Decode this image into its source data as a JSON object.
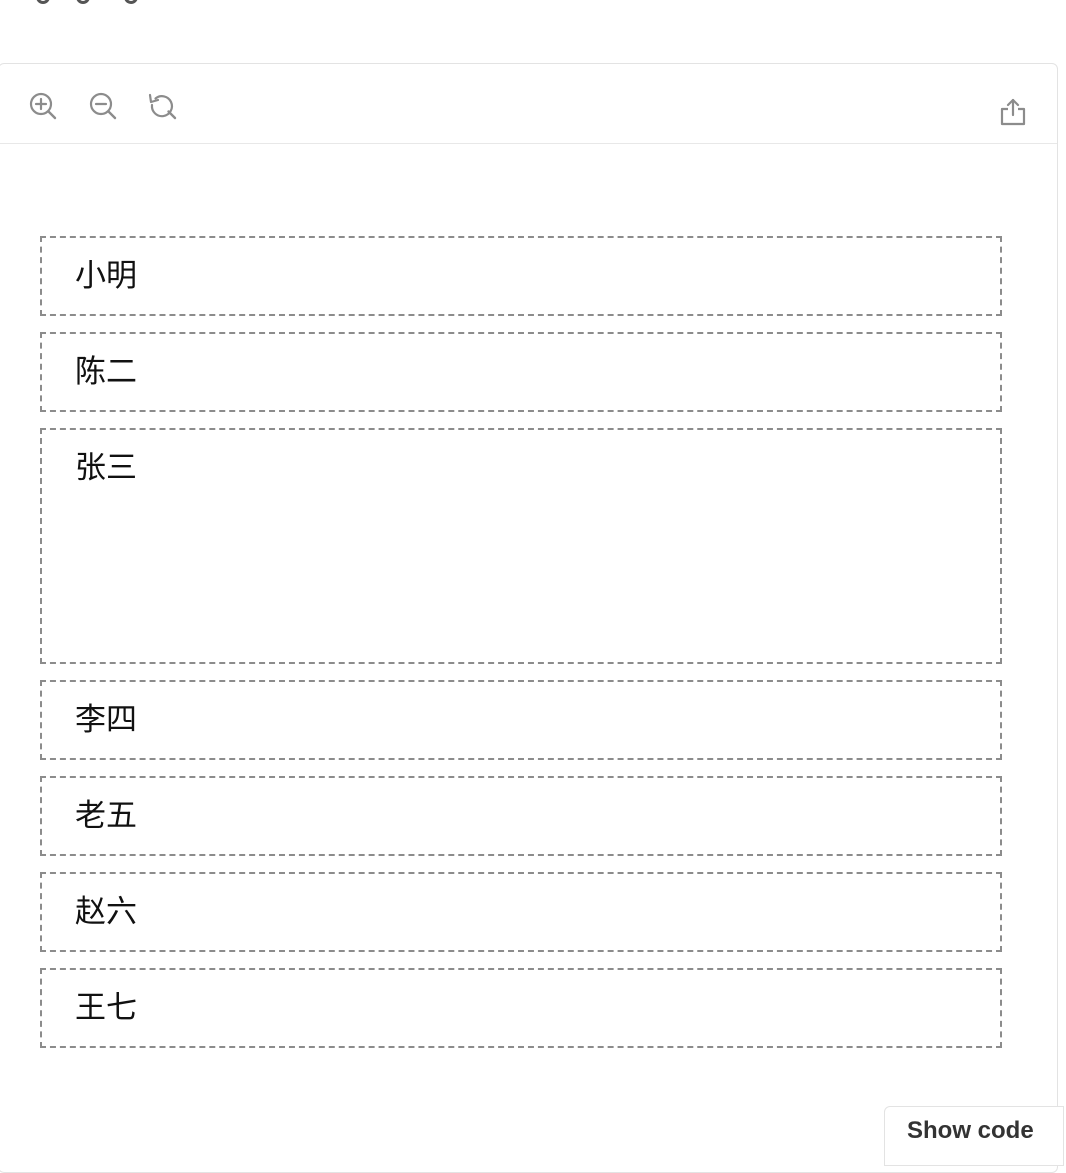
{
  "toolbar": {
    "zoom_in_icon": "zoom-in-icon",
    "zoom_out_icon": "zoom-out-icon",
    "reset_icon": "reset-icon",
    "export_icon": "export-icon"
  },
  "names": [
    {
      "label": "小明"
    },
    {
      "label": "陈二"
    },
    {
      "label": "张三"
    },
    {
      "label": "李四"
    },
    {
      "label": "老五"
    },
    {
      "label": "赵六"
    },
    {
      "label": "王七"
    }
  ],
  "show_code_label": "Show code",
  "colors": {
    "icon": "#8c8c8c",
    "box_border": "#8c8c8c",
    "panel_border": "#e3e3e3",
    "text": "#111111"
  }
}
